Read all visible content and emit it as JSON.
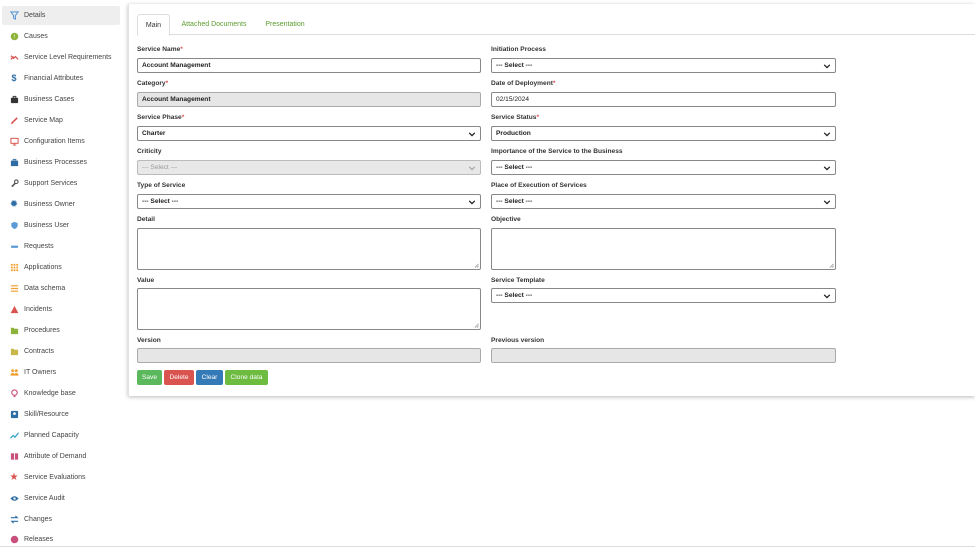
{
  "sidebar": {
    "items": [
      {
        "label": "Details",
        "icon": "funnel-icon",
        "color": "#5b9bd5",
        "active": true
      },
      {
        "label": "Causes",
        "icon": "causes-circle-icon",
        "color": "#8db33a"
      },
      {
        "label": "Service Level Requirements",
        "icon": "handshake-icon",
        "color": "#d9534f"
      },
      {
        "label": "Financial Attributes",
        "icon": "dollar-icon",
        "color": "#2e6da4"
      },
      {
        "label": "Business Cases",
        "icon": "briefcase-icon",
        "color": "#333333"
      },
      {
        "label": "Service Map",
        "icon": "pencil-icon",
        "color": "#d9534f"
      },
      {
        "label": "Configuration Items",
        "icon": "monitor-icon",
        "color": "#d9534f"
      },
      {
        "label": "Business Processes",
        "icon": "toolbox-icon",
        "color": "#2e6da4"
      },
      {
        "label": "Support Services",
        "icon": "wrench-icon",
        "color": "#555555"
      },
      {
        "label": "Business Owner",
        "icon": "gear-icon",
        "color": "#2e6da4"
      },
      {
        "label": "Business User",
        "icon": "shield-user-icon",
        "color": "#5b9bd5"
      },
      {
        "label": "Requests",
        "icon": "requests-bar-icon",
        "color": "#5b9bd5"
      },
      {
        "label": "Applications",
        "icon": "grid-icon",
        "color": "#f0a030"
      },
      {
        "label": "Data schema",
        "icon": "lines-icon",
        "color": "#f0a030"
      },
      {
        "label": "Incidents",
        "icon": "warning-triangle-icon",
        "color": "#d9534f"
      },
      {
        "label": "Procedures",
        "icon": "folder-icon",
        "color": "#8db33a"
      },
      {
        "label": "Contracts",
        "icon": "folder-icon",
        "color": "#c8b84a"
      },
      {
        "label": "IT Owners",
        "icon": "users-icon",
        "color": "#f0a030"
      },
      {
        "label": "Knowledge base",
        "icon": "lightbulb-icon",
        "color": "#c94f7c"
      },
      {
        "label": "Skill/Resource",
        "icon": "id-card-icon",
        "color": "#2e6da4"
      },
      {
        "label": "Planned Capacity",
        "icon": "line-chart-icon",
        "color": "#2aa0c8"
      },
      {
        "label": "Attribute of Demand",
        "icon": "book-icon",
        "color": "#c94f7c"
      },
      {
        "label": "Service Evaluations",
        "icon": "star-icon",
        "color": "#d9534f"
      },
      {
        "label": "Service Audit",
        "icon": "eye-icon",
        "color": "#2e6da4"
      },
      {
        "label": "Changes",
        "icon": "exchange-icon",
        "color": "#2e6da4"
      },
      {
        "label": "Releases",
        "icon": "release-circle-icon",
        "color": "#c94f7c"
      }
    ]
  },
  "tabs": [
    {
      "label": "Main",
      "active": true
    },
    {
      "label": "Attached Documents",
      "active": false
    },
    {
      "label": "Presentation",
      "active": false
    }
  ],
  "form": {
    "service_name": {
      "label": "Service Name",
      "value": "Account Management"
    },
    "category": {
      "label": "Category",
      "value": "Account Management"
    },
    "service_phase": {
      "label": "Service Phase",
      "value": "Charter"
    },
    "criticity": {
      "label": "Criticity",
      "value": "--- Select ---"
    },
    "type_of_service": {
      "label": "Type of Service",
      "value": "--- Select ---"
    },
    "detail": {
      "label": "Detail"
    },
    "value": {
      "label": "Value"
    },
    "version": {
      "label": "Version"
    },
    "initiation_process": {
      "label": "Initiation Process",
      "value": "--- Select ---"
    },
    "date_of_deployment": {
      "label": "Date of Deployment",
      "value": "02/15/2024"
    },
    "service_status": {
      "label": "Service Status",
      "value": "Production"
    },
    "importance": {
      "label": "Importance of the Service to the Business",
      "value": "--- Select ---"
    },
    "place_of_execution": {
      "label": "Place of Execution of Services",
      "value": "--- Select ---"
    },
    "objective": {
      "label": "Objective"
    },
    "service_template": {
      "label": "Service Template",
      "value": "--- Select ---"
    },
    "previous_version": {
      "label": "Previous version"
    }
  },
  "required_marker": "*",
  "buttons": {
    "save": {
      "label": "Save",
      "color": "#5cb85c"
    },
    "delete": {
      "label": "Delete",
      "color": "#d9534f"
    },
    "clear": {
      "label": "Clear",
      "color": "#337ab7"
    },
    "clone": {
      "label": "Clone data",
      "color": "#6dbb3f"
    }
  },
  "colors": {
    "tab_link": "#5a9d2e",
    "required": "#d9534f"
  }
}
